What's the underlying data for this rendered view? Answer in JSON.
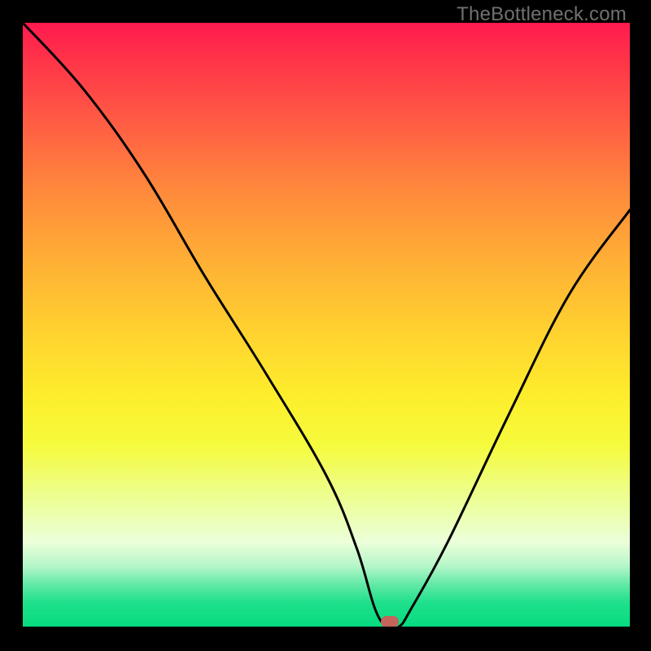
{
  "watermark": "TheBottleneck.com",
  "chart_data": {
    "type": "line",
    "title": "",
    "xlabel": "",
    "ylabel": "",
    "xlim": [
      0,
      100
    ],
    "ylim": [
      0,
      100
    ],
    "grid": false,
    "series": [
      {
        "name": "bottleneck-curve",
        "x": [
          0,
          10,
          20,
          30,
          40,
          50,
          55,
          58,
          60,
          62,
          64,
          70,
          80,
          90,
          100
        ],
        "values": [
          100,
          89,
          75,
          58,
          42,
          25,
          13,
          3,
          0,
          0,
          3,
          14,
          35,
          55,
          69
        ]
      }
    ],
    "annotations": [
      {
        "name": "minimum-marker",
        "x": 60.5,
        "y": 0
      }
    ],
    "background_gradient_stops": [
      {
        "pos": 0.0,
        "color": "#ff1a4f"
      },
      {
        "pos": 0.5,
        "color": "#ffd42f"
      },
      {
        "pos": 1.0,
        "color": "#06db7f"
      }
    ]
  }
}
